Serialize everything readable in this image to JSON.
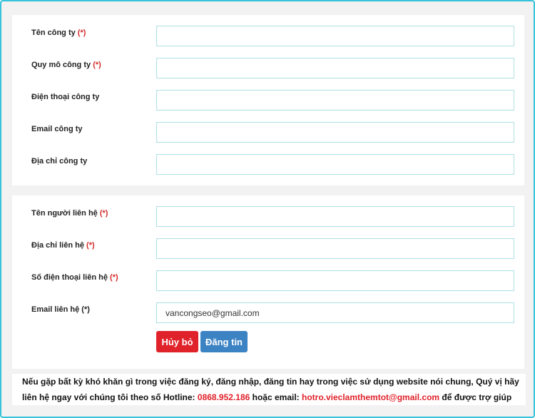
{
  "company": {
    "fields": [
      {
        "label": "Tên công ty",
        "required": "(*)",
        "value": ""
      },
      {
        "label": "Quy mô công ty",
        "required": "(*)",
        "value": ""
      },
      {
        "label": "Điện thoại công ty",
        "required": "",
        "value": ""
      },
      {
        "label": "Email công ty",
        "required": "",
        "value": ""
      },
      {
        "label": "Địa chỉ công ty",
        "required": "",
        "value": ""
      }
    ]
  },
  "contact": {
    "fields": [
      {
        "label": "Tên người liên hệ",
        "required": "(*)",
        "value": ""
      },
      {
        "label": "Địa chỉ liên hệ",
        "required": "(*)",
        "value": ""
      },
      {
        "label": "Số điện thoại liên hệ",
        "required": "(*)",
        "value": ""
      },
      {
        "label": "Email liên hệ (*)",
        "required": "",
        "value": "vancongseo@gmail.com"
      }
    ]
  },
  "buttons": {
    "cancel_label": "Hủy bỏ",
    "submit_label": "Đăng tin"
  },
  "help": {
    "text_before": "Nếu gặp bất kỳ khó khăn gì trong việc đăng ký, đăng nhập, đăng tin hay trong việc sử dụng website nói chung, Quý vị hãy liên hệ ngay với chúng tôi theo số Hotline: ",
    "hotline": "0868.952.186",
    "text_middle": " hoặc email: ",
    "email": "hotro.vieclamthemtot@gmail.com",
    "text_after": " để được trợ giúp"
  },
  "colors": {
    "frame_border": "#36c3dc",
    "required_red": "#d52b2b",
    "cancel_button": "#e0222b",
    "submit_button": "#3c83c4",
    "input_border": "#aee0e2"
  }
}
